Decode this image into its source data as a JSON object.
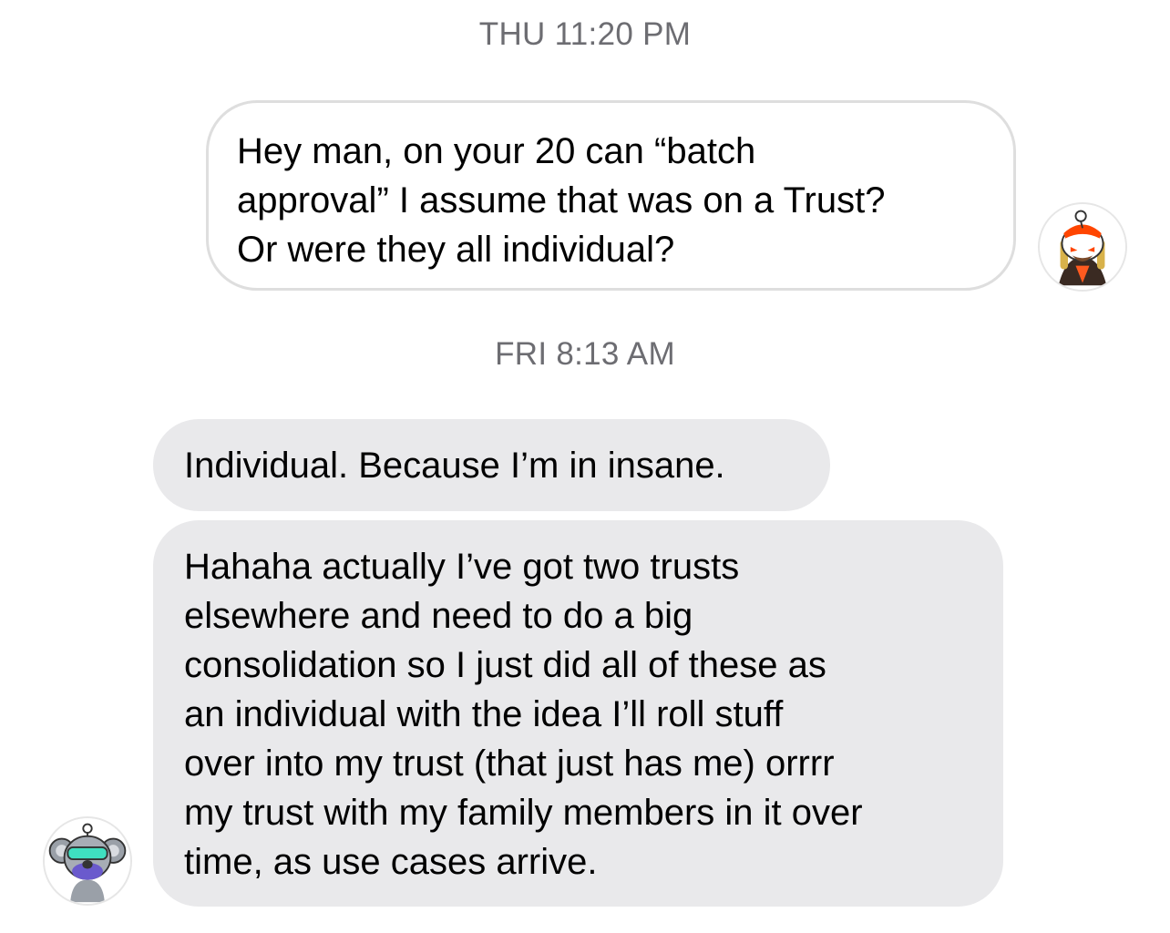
{
  "conversation": {
    "timestamps": {
      "thu": "THU 11:20 PM",
      "fri": "FRI 8:13 AM"
    },
    "outgoing": {
      "lines": [
        "Hey man, on your 20 can “batch",
        "approval” I assume that was on a Trust?",
        "Or were they all individual?"
      ]
    },
    "incoming": [
      {
        "lines": [
          "Individual. Because I’m in insane."
        ]
      },
      {
        "lines": [
          "Hahaha actually I’ve got two trusts",
          "elsewhere and need to do a big",
          "consolidation so I just did all of these as",
          "an individual with the idea I’ll roll stuff",
          "over into my trust (that just has me) orrrr",
          "my trust with my family members in it over",
          "time, as use cases arrive."
        ]
      }
    ]
  },
  "avatars": {
    "sender": {
      "icon": "cartoon-robot-avatar-icon"
    },
    "receiver": {
      "icon": "cartoon-koala-avatar-icon"
    }
  },
  "colors": {
    "timestamp": "#6d6d72",
    "incoming_bubble": "#e9e9eb",
    "outgoing_border": "#dedede"
  }
}
